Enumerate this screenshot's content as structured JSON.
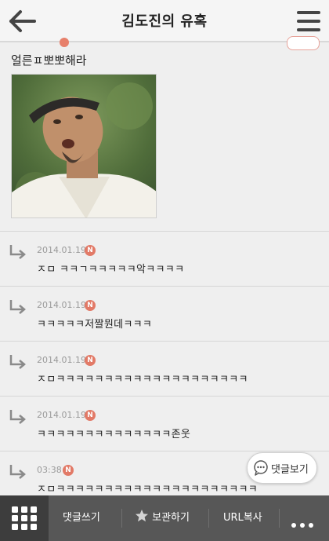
{
  "header": {
    "title": "김도진의 유혹"
  },
  "post": {
    "text": "얼른ㅍ뽀뽀해라"
  },
  "comments": [
    {
      "date": "2014.01.19",
      "badge": "N",
      "text": "ㅈㅁ ㅋㅋㄱㅋㅋㅋㅋㅋ악ㅋㅋㅋㅋ"
    },
    {
      "date": "2014.01.19",
      "badge": "N",
      "text": "ㅋㅋㅋㅋㅋ저짤뭔데ㅋㅋㅋ"
    },
    {
      "date": "2014.01.19",
      "badge": "N",
      "text": "ㅈㅁㅋㅋㅋㅋㅋㅋㅋㅋㅋㅋㅋㅋㅋㅋㅋㅋㅋㅋㅋㅋ"
    },
    {
      "date": "2014.01.19",
      "badge": "N",
      "text": "ㅋㅋㅋㅋㅋㅋㅋㅋㅋㅋㅋㅋㅋㅋ존웃"
    },
    {
      "date": "03:38",
      "badge": "N",
      "text": "ㅈㅁㅋㅋㅋㅋㅋㅋㅋㅋㅋㅋㅋㅋㅋㅋㅋㅋㅋㅋㅋㅋㅋ"
    }
  ],
  "float_button": {
    "label": "댓글보기"
  },
  "bottom_bar": {
    "comment_label": "댓글쓰기",
    "bookmark_label": "보관하기",
    "url_label": "URL복사"
  },
  "colors": {
    "accent_badge": "#e27a67",
    "bottom_bar": "#575757"
  }
}
